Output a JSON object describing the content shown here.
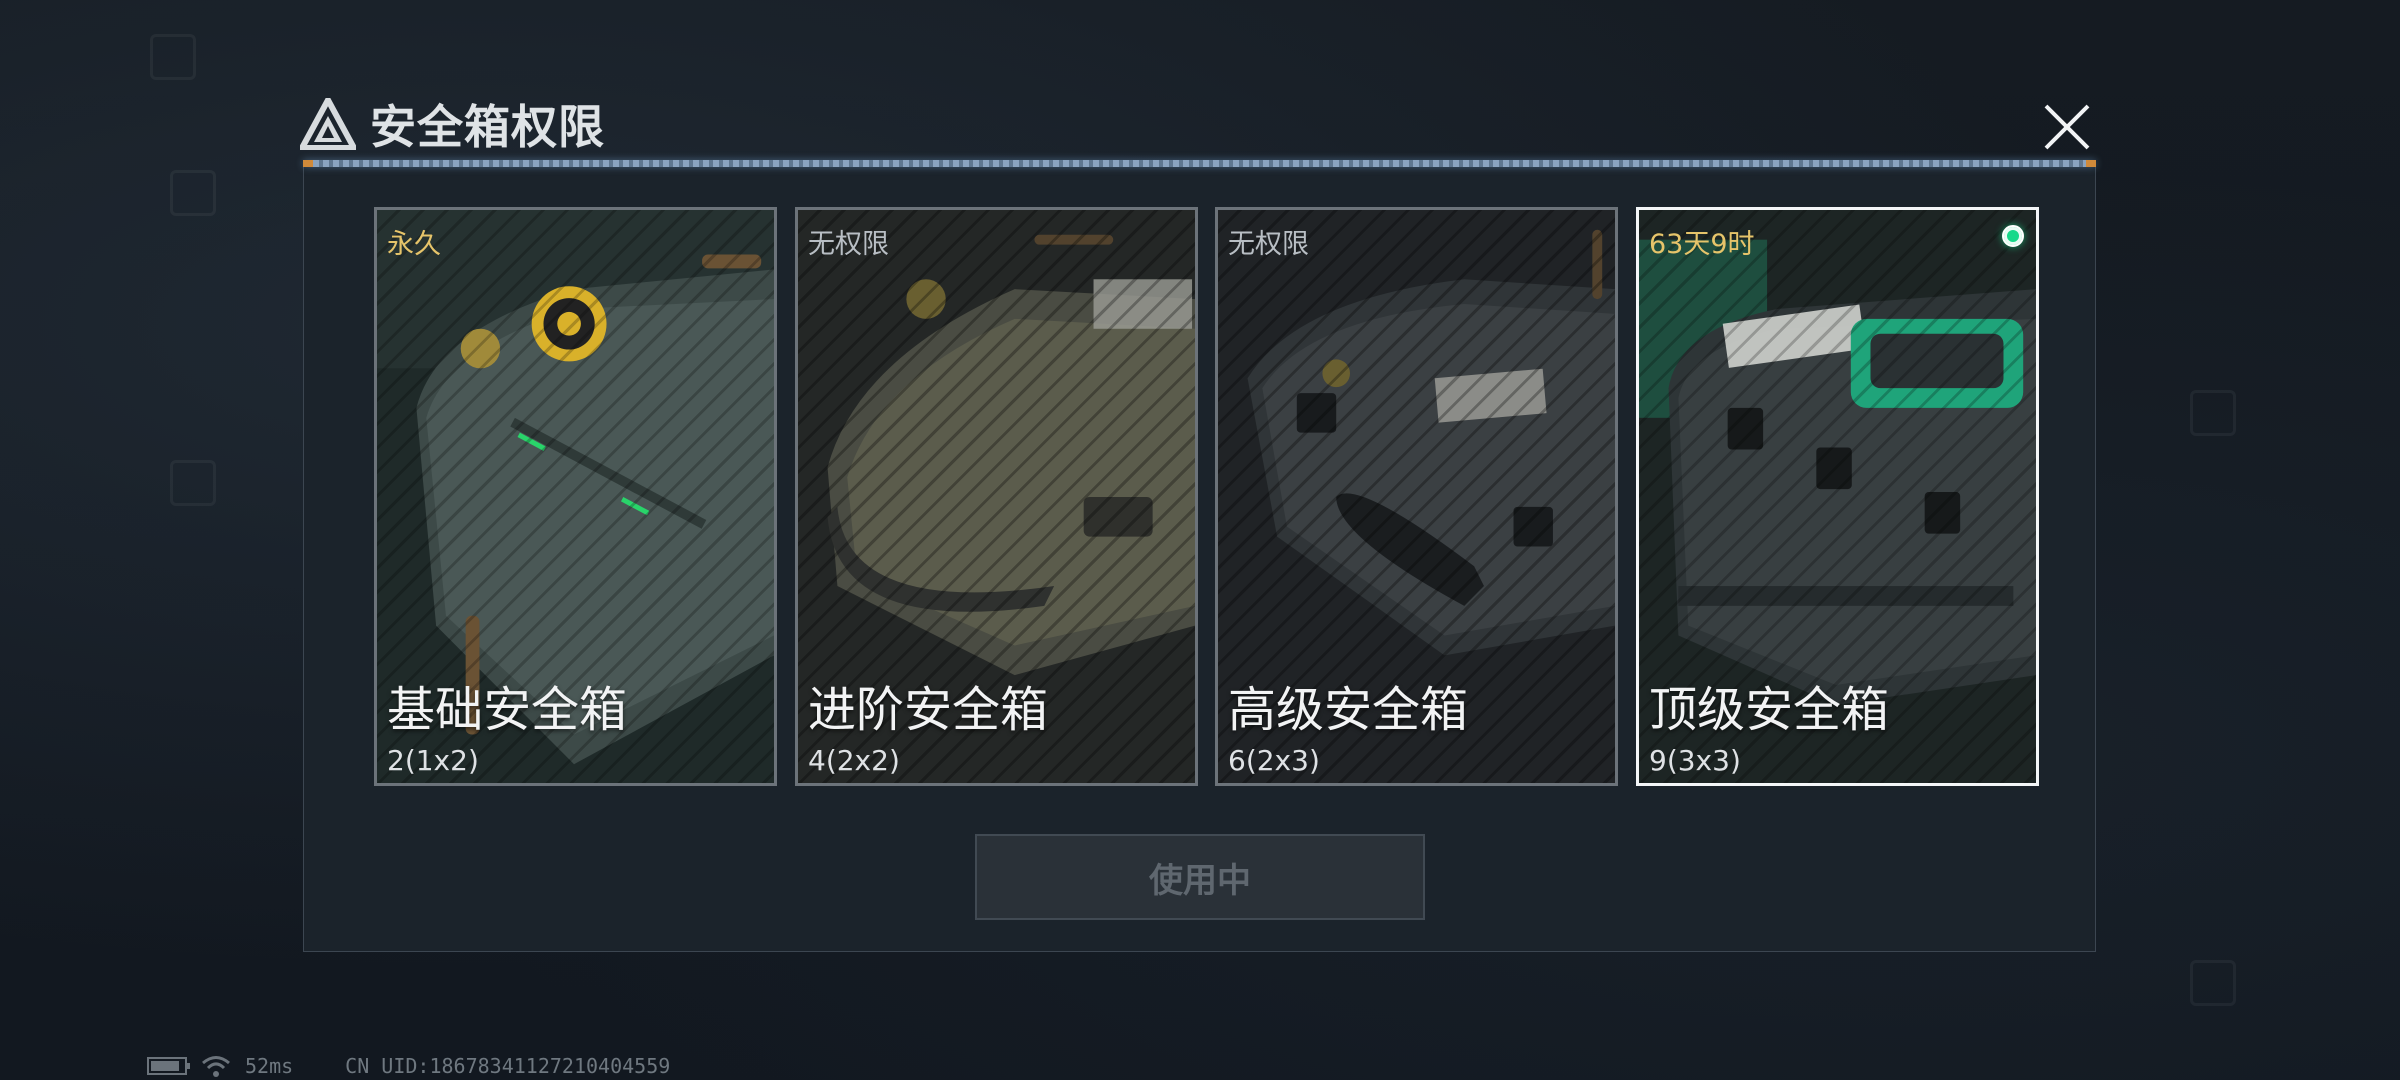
{
  "dialog": {
    "title": "安全箱权限"
  },
  "cards": [
    {
      "name": "基础安全箱",
      "size": "2(1x2)",
      "status": "永久",
      "status_color": "#e6c46a",
      "selected": false
    },
    {
      "name": "进阶安全箱",
      "size": "4(2x2)",
      "status": "无权限",
      "status_color": "#b8bec4",
      "selected": false
    },
    {
      "name": "高级安全箱",
      "size": "6(2x3)",
      "status": "无权限",
      "status_color": "#b8bec4",
      "selected": false
    },
    {
      "name": "顶级安全箱",
      "size": "9(3x3)",
      "status": "63天9时",
      "status_color": "#e6c46a",
      "selected": true
    }
  ],
  "use_button": {
    "label": "使用中"
  },
  "status_bar": {
    "ping": "52ms",
    "uid": "CN UID:1867834112721040455​9"
  },
  "colors": {
    "active_dot": "#17d98a",
    "accent_line": "#8aa3bf",
    "status_gold": "#e6c46a"
  }
}
